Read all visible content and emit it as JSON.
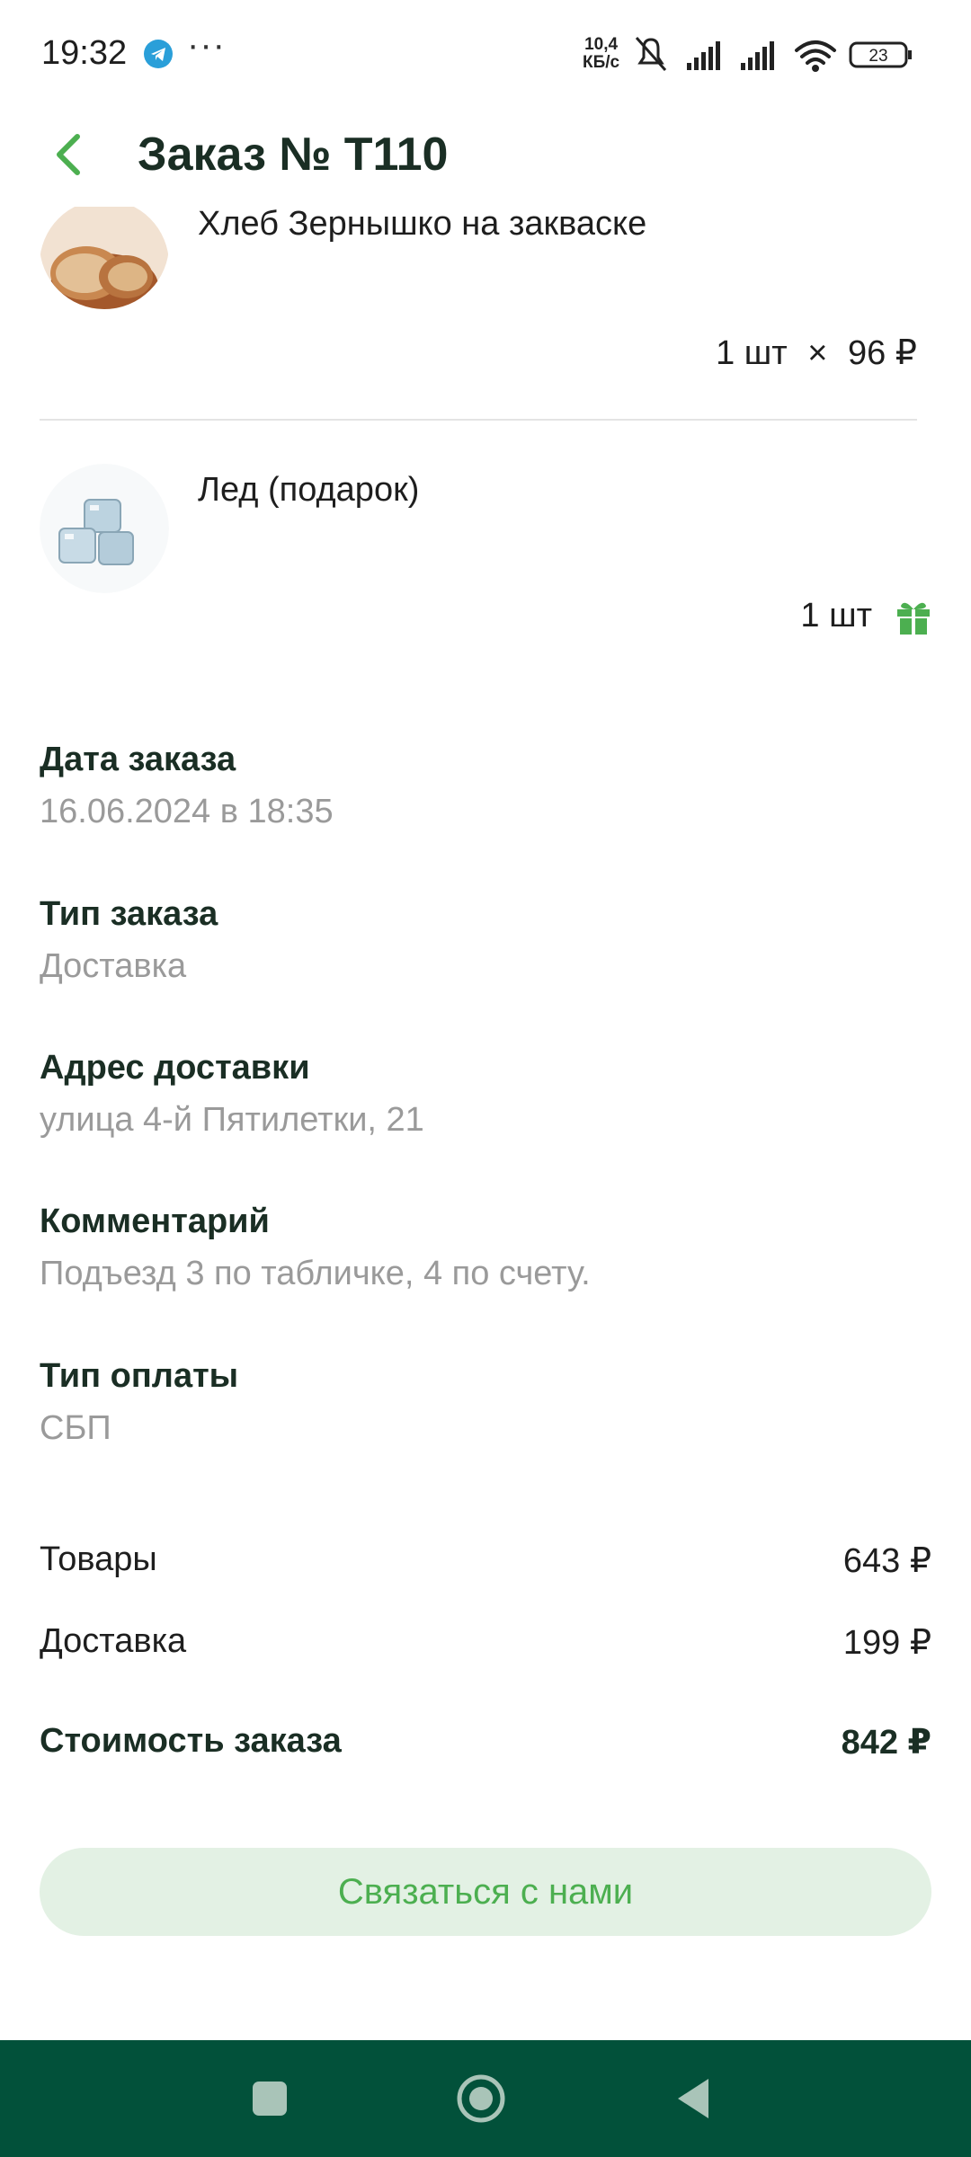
{
  "status_bar": {
    "time": "19:32",
    "network_speed_value": "10,4",
    "network_speed_unit": "КБ/с",
    "battery": "23"
  },
  "header": {
    "title": "Заказ № Т110"
  },
  "items": [
    {
      "name": "Хлеб Зернышко на закваске",
      "quantity": "1 шт",
      "multiply": "×",
      "price": "96 ₽"
    },
    {
      "name": "Лед (подарок)",
      "quantity": "1 шт",
      "badge": "gift-icon"
    }
  ],
  "details": {
    "date": {
      "label": "Дата заказа",
      "value": "16.06.2024 в 18:35"
    },
    "type": {
      "label": "Тип заказа",
      "value": "Доставка"
    },
    "address": {
      "label": "Адрес доставки",
      "value": "улица 4-й Пятилетки, 21"
    },
    "comment": {
      "label": "Комментарий",
      "value": "Подъезд 3 по табличке, 4 по счету."
    },
    "payment": {
      "label": "Тип оплаты",
      "value": "СБП"
    }
  },
  "totals": {
    "goods": {
      "label": "Товары",
      "value": "643 ₽"
    },
    "delivery": {
      "label": "Доставка",
      "value": "199 ₽"
    },
    "order": {
      "label": "Стоимость заказа",
      "value": "842 ₽"
    }
  },
  "contact_button": "Связаться с нами",
  "colors": {
    "accent": "#4caf50",
    "button_bg": "#e3f1e4",
    "nav_bar": "#02513a",
    "muted_text": "#9a9a9a",
    "title_text": "#1a2e24"
  }
}
